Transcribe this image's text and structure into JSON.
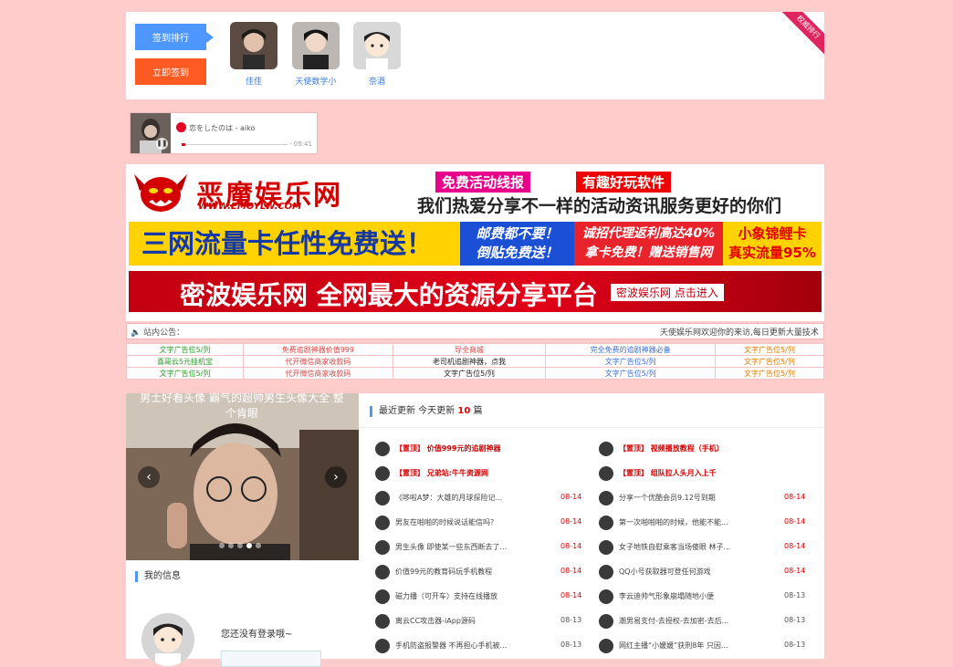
{
  "signin": {
    "rank_label": "签到排行",
    "sign_label": "立即签到",
    "ribbon": "权威排行",
    "users": [
      {
        "name": "佳佳"
      },
      {
        "name": "天使数学小"
      },
      {
        "name": "奈酒"
      }
    ]
  },
  "player": {
    "title": "恋をしたのは - aiko",
    "time": "- 05:41"
  },
  "banners": {
    "b1_logo": "恶魔娱乐网",
    "b1_url": "WWW.EMOYLW.COM",
    "b1_tag1": "免费活动线报",
    "b1_tag2": "有趣好玩软件",
    "b1_slogan": "我们热爱分享不一样的活动资讯服务更好的你们",
    "b2_p1": "三网流量卡任性免费送！",
    "b2_p2a": "邮费都不要！",
    "b2_p2b": "倒贴免费送！",
    "b2_p3a": "诚招代理返利高达40%",
    "b2_p3b": "拿卡免费！赠送销售网",
    "b2_p4a": "小象锦鲤卡",
    "b2_p4b": "真实流量95%",
    "b3_text": "密波娱乐网 全网最大的资源分享平台",
    "b3_enter": "密波娱乐网 点击进入"
  },
  "notice": {
    "label": "站内公告：",
    "message": "天使娱乐网欢迎你的来访,每日更新大量技术"
  },
  "ads": [
    [
      {
        "t": "文字广告位5/列",
        "c": "#2a9a2a"
      },
      {
        "t": "免费追剧神器价值999",
        "c": "#e04040"
      },
      {
        "t": "导全商城",
        "c": "#e04040"
      },
      {
        "t": "完全免费的追剧神器必备",
        "c": "#3a6fd8"
      },
      {
        "t": "文字广告位5/列",
        "c": "#e07b00"
      }
    ],
    [
      {
        "t": "喜哥云5元挂机宝",
        "c": "#2a9a2a"
      },
      {
        "t": "代开微信商家收款码",
        "c": "#e04040"
      },
      {
        "t": "老司机追剧神器，点我",
        "c": "#222"
      },
      {
        "t": "文字广告位5/列",
        "c": "#3a6fd8"
      },
      {
        "t": "文字广告位5/列",
        "c": "#e07b00"
      }
    ],
    [
      {
        "t": "文字广告位5/列",
        "c": "#2a9a2a"
      },
      {
        "t": "代开微信商家收款码",
        "c": "#e04040"
      },
      {
        "t": "文字广告位5/列",
        "c": "#222"
      },
      {
        "t": "文字广告位5/列",
        "c": "#3a6fd8"
      },
      {
        "t": "文字广告位5/列",
        "c": "#e07b00"
      }
    ]
  ],
  "carousel": {
    "caption": "男士好看头像 霸气的超帅男生头像大全 整个肯眼"
  },
  "myinfo": {
    "heading": "我的信息",
    "message": "您还没有登录哦~"
  },
  "updates": {
    "heading_prefix": "最近更新 今天更新",
    "count": "10",
    "heading_suffix": "篇",
    "items": [
      {
        "t": "【置顶】 价值999元的追剧神器",
        "d": "",
        "top": true
      },
      {
        "t": "【置顶】 视频播放教程（手机）",
        "d": "",
        "top": true
      },
      {
        "t": "【置顶】 兄弟站:牛牛资源网",
        "d": "",
        "top": true
      },
      {
        "t": "【置顶】 组队拉人头月入上千",
        "d": "",
        "top": true
      },
      {
        "t": "《哆啦A梦：大雄的月球探险记...",
        "d": "08-14",
        "top": false
      },
      {
        "t": "分享一个优酷会员9.12号到期",
        "d": "08-14",
        "top": false
      },
      {
        "t": "男友在啪啪的时候说话能信吗？",
        "d": "08-14",
        "top": false
      },
      {
        "t": "第一次啪啪啪的时候，他能不能...",
        "d": "08-14",
        "top": false
      },
      {
        "t": "男生头像 即使某一些东西断去了...",
        "d": "08-14",
        "top": false
      },
      {
        "t": "女子地铁自慰乘客当场傻眼 林子...",
        "d": "08-14",
        "top": false
      },
      {
        "t": "价值99元的教育码玩手机教程",
        "d": "08-14",
        "top": false
      },
      {
        "t": "QQ小号获取器可登任何游戏",
        "d": "08-14",
        "top": false
      },
      {
        "t": "磁力播（可开车）支持在线播放",
        "d": "08-14",
        "top": false
      },
      {
        "t": "李云迪帅气形象崩塌随地小便",
        "d": "08-13",
        "top": false
      },
      {
        "t": "离云CC攻击器-iApp源码",
        "d": "08-13",
        "top": false
      },
      {
        "t": "潮男易支付-去授权-去加密-去后...",
        "d": "08-13",
        "top": false
      },
      {
        "t": "手机防盗报警器 不再担心手机被...",
        "d": "08-13",
        "top": false
      },
      {
        "t": "网红主播“小媛媛”获刑8年 只因...",
        "d": "08-13",
        "top": false
      }
    ]
  },
  "colors": {
    "accent": "#4d97ff",
    "date_red": "#e00000",
    "date_gray": "#555555",
    "bg": "#ffcccc"
  }
}
